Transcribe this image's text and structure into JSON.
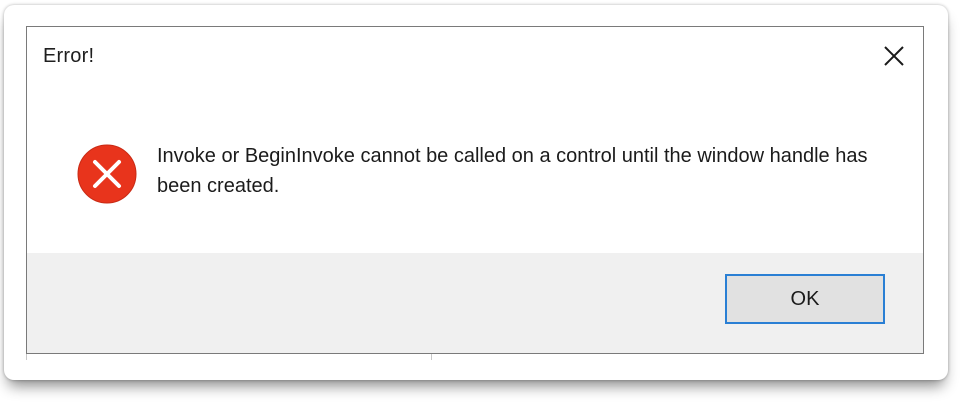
{
  "dialog": {
    "title": "Error!",
    "message": "Invoke or BeginInvoke cannot be called on a control until the window handle has been created.",
    "ok_label": "OK"
  },
  "icons": {
    "close": "close-icon",
    "error": "error-icon"
  },
  "colors": {
    "error_red": "#e8341c",
    "button_border": "#2a7fd4",
    "footer_bg": "#f0f0f0",
    "button_bg": "#e1e1e1"
  }
}
